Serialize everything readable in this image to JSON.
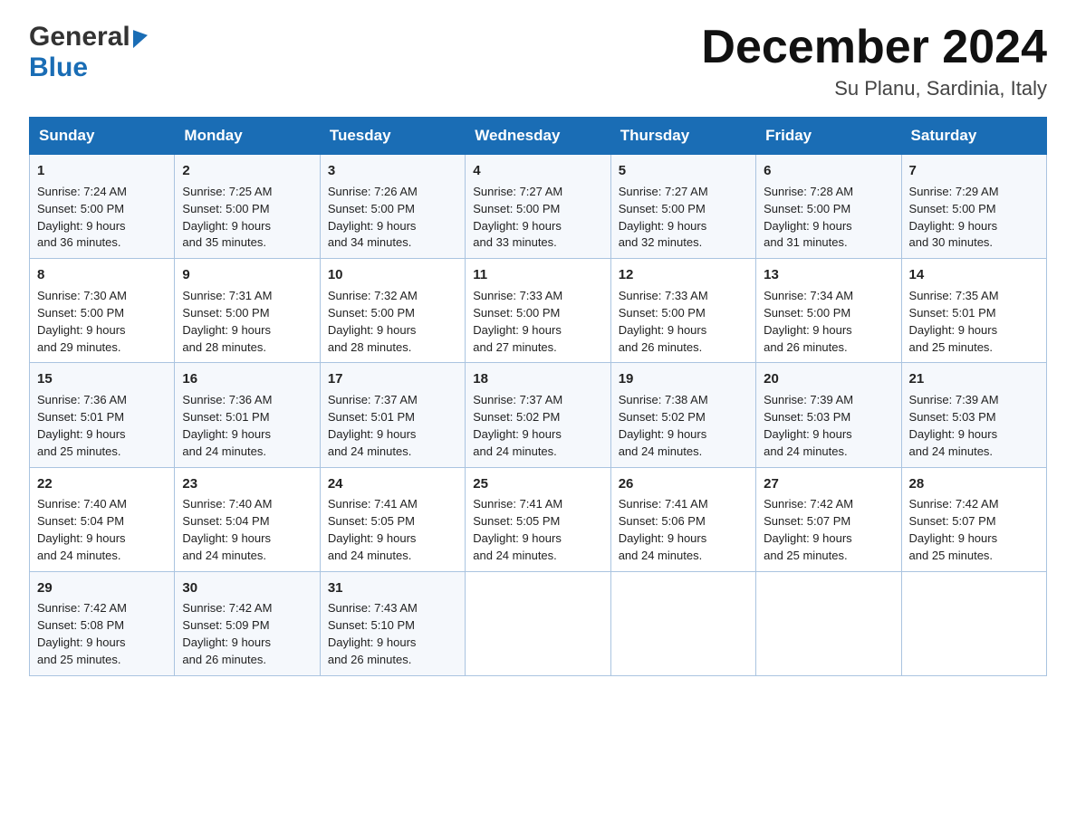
{
  "logo": {
    "line1": "General",
    "triangle": "▶",
    "line2": "Blue"
  },
  "header": {
    "month": "December 2024",
    "location": "Su Planu, Sardinia, Italy"
  },
  "days_of_week": [
    "Sunday",
    "Monday",
    "Tuesday",
    "Wednesday",
    "Thursday",
    "Friday",
    "Saturday"
  ],
  "weeks": [
    [
      {
        "day": "1",
        "sunrise": "7:24 AM",
        "sunset": "5:00 PM",
        "daylight": "9 hours and 36 minutes."
      },
      {
        "day": "2",
        "sunrise": "7:25 AM",
        "sunset": "5:00 PM",
        "daylight": "9 hours and 35 minutes."
      },
      {
        "day": "3",
        "sunrise": "7:26 AM",
        "sunset": "5:00 PM",
        "daylight": "9 hours and 34 minutes."
      },
      {
        "day": "4",
        "sunrise": "7:27 AM",
        "sunset": "5:00 PM",
        "daylight": "9 hours and 33 minutes."
      },
      {
        "day": "5",
        "sunrise": "7:27 AM",
        "sunset": "5:00 PM",
        "daylight": "9 hours and 32 minutes."
      },
      {
        "day": "6",
        "sunrise": "7:28 AM",
        "sunset": "5:00 PM",
        "daylight": "9 hours and 31 minutes."
      },
      {
        "day": "7",
        "sunrise": "7:29 AM",
        "sunset": "5:00 PM",
        "daylight": "9 hours and 30 minutes."
      }
    ],
    [
      {
        "day": "8",
        "sunrise": "7:30 AM",
        "sunset": "5:00 PM",
        "daylight": "9 hours and 29 minutes."
      },
      {
        "day": "9",
        "sunrise": "7:31 AM",
        "sunset": "5:00 PM",
        "daylight": "9 hours and 28 minutes."
      },
      {
        "day": "10",
        "sunrise": "7:32 AM",
        "sunset": "5:00 PM",
        "daylight": "9 hours and 28 minutes."
      },
      {
        "day": "11",
        "sunrise": "7:33 AM",
        "sunset": "5:00 PM",
        "daylight": "9 hours and 27 minutes."
      },
      {
        "day": "12",
        "sunrise": "7:33 AM",
        "sunset": "5:00 PM",
        "daylight": "9 hours and 26 minutes."
      },
      {
        "day": "13",
        "sunrise": "7:34 AM",
        "sunset": "5:00 PM",
        "daylight": "9 hours and 26 minutes."
      },
      {
        "day": "14",
        "sunrise": "7:35 AM",
        "sunset": "5:01 PM",
        "daylight": "9 hours and 25 minutes."
      }
    ],
    [
      {
        "day": "15",
        "sunrise": "7:36 AM",
        "sunset": "5:01 PM",
        "daylight": "9 hours and 25 minutes."
      },
      {
        "day": "16",
        "sunrise": "7:36 AM",
        "sunset": "5:01 PM",
        "daylight": "9 hours and 24 minutes."
      },
      {
        "day": "17",
        "sunrise": "7:37 AM",
        "sunset": "5:01 PM",
        "daylight": "9 hours and 24 minutes."
      },
      {
        "day": "18",
        "sunrise": "7:37 AM",
        "sunset": "5:02 PM",
        "daylight": "9 hours and 24 minutes."
      },
      {
        "day": "19",
        "sunrise": "7:38 AM",
        "sunset": "5:02 PM",
        "daylight": "9 hours and 24 minutes."
      },
      {
        "day": "20",
        "sunrise": "7:39 AM",
        "sunset": "5:03 PM",
        "daylight": "9 hours and 24 minutes."
      },
      {
        "day": "21",
        "sunrise": "7:39 AM",
        "sunset": "5:03 PM",
        "daylight": "9 hours and 24 minutes."
      }
    ],
    [
      {
        "day": "22",
        "sunrise": "7:40 AM",
        "sunset": "5:04 PM",
        "daylight": "9 hours and 24 minutes."
      },
      {
        "day": "23",
        "sunrise": "7:40 AM",
        "sunset": "5:04 PM",
        "daylight": "9 hours and 24 minutes."
      },
      {
        "day": "24",
        "sunrise": "7:41 AM",
        "sunset": "5:05 PM",
        "daylight": "9 hours and 24 minutes."
      },
      {
        "day": "25",
        "sunrise": "7:41 AM",
        "sunset": "5:05 PM",
        "daylight": "9 hours and 24 minutes."
      },
      {
        "day": "26",
        "sunrise": "7:41 AM",
        "sunset": "5:06 PM",
        "daylight": "9 hours and 24 minutes."
      },
      {
        "day": "27",
        "sunrise": "7:42 AM",
        "sunset": "5:07 PM",
        "daylight": "9 hours and 25 minutes."
      },
      {
        "day": "28",
        "sunrise": "7:42 AM",
        "sunset": "5:07 PM",
        "daylight": "9 hours and 25 minutes."
      }
    ],
    [
      {
        "day": "29",
        "sunrise": "7:42 AM",
        "sunset": "5:08 PM",
        "daylight": "9 hours and 25 minutes."
      },
      {
        "day": "30",
        "sunrise": "7:42 AM",
        "sunset": "5:09 PM",
        "daylight": "9 hours and 26 minutes."
      },
      {
        "day": "31",
        "sunrise": "7:43 AM",
        "sunset": "5:10 PM",
        "daylight": "9 hours and 26 minutes."
      },
      null,
      null,
      null,
      null
    ]
  ],
  "labels": {
    "sunrise": "Sunrise:",
    "sunset": "Sunset:",
    "daylight": "Daylight:"
  }
}
